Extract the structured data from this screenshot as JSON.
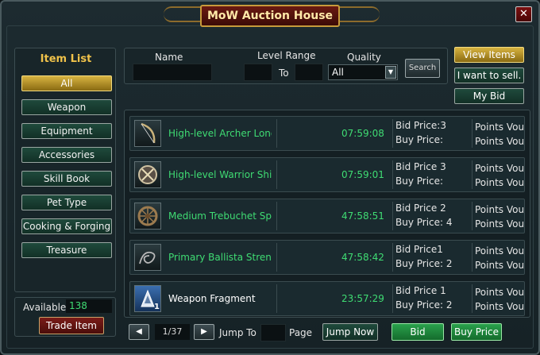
{
  "window": {
    "title": "MoW Auction House",
    "close_label": "✕"
  },
  "left_panel": {
    "title": "Item List",
    "categories": [
      {
        "label": "All"
      },
      {
        "label": "Weapon"
      },
      {
        "label": "Equipment"
      },
      {
        "label": "Accessories"
      },
      {
        "label": "Skill Book"
      },
      {
        "label": "Pet Type"
      },
      {
        "label": "Cooking & Forging"
      },
      {
        "label": "Treasure"
      }
    ]
  },
  "available": {
    "label": "Available",
    "value": "138",
    "trade_label": "Trade Item"
  },
  "search": {
    "name_label": "Name",
    "name_value": "",
    "level_label": "Level Range",
    "to_label": "To",
    "level_from": "",
    "level_to": "",
    "quality_label": "Quality",
    "quality_value": "All",
    "search_label": "Search"
  },
  "actions": {
    "view_items": "View Items",
    "sell": "I want to sell.",
    "my_bid": "My Bid"
  },
  "items": [
    {
      "name": "High-level Archer Long",
      "time": "07:59:08",
      "bid": "Bid Price:3",
      "buy": "Buy Price:",
      "points1": "Points Vou",
      "points2": "Points Vou",
      "icon": "bow-icon",
      "name_color": "#3fdc73",
      "qty": ""
    },
    {
      "name": "High-level Warrior Shie",
      "time": "07:59:01",
      "bid": "Bid Price 3",
      "buy": "Buy Price:",
      "points1": "Points Vou",
      "points2": "Points Vou",
      "icon": "shield-icon",
      "name_color": "#3fdc73",
      "qty": ""
    },
    {
      "name": "Medium Trebuchet Spir",
      "time": "47:58:51",
      "bid": "Bid Price 2",
      "buy": "Buy Price: 4",
      "points1": "Points Vou",
      "points2": "Points Vou",
      "icon": "wheel-icon",
      "name_color": "#3fdc73",
      "qty": ""
    },
    {
      "name": "Primary Ballista Strengt",
      "time": "47:58:42",
      "bid": "Bid Price1",
      "buy": "Buy Price: 2",
      "points1": "Points Vou",
      "points2": "Points Vou",
      "icon": "rope-icon",
      "name_color": "#3fdc73",
      "qty": ""
    },
    {
      "name": "Weapon Fragment",
      "time": "23:57:29",
      "bid": "Bid Price 1",
      "buy": "Buy Price: 2",
      "points1": "Points Vou",
      "points2": "Points Vou",
      "icon": "fragment-icon",
      "name_color": "#ffffff",
      "qty": "1"
    }
  ],
  "pagination": {
    "prev": "◀",
    "next": "▶",
    "page": "1/37",
    "jump_label": "Jump To",
    "jump_value": "",
    "page_label": "Page",
    "jump_now": "Jump Now"
  },
  "bottom": {
    "bid": "Bid",
    "buy_price": "Buy Price"
  }
}
